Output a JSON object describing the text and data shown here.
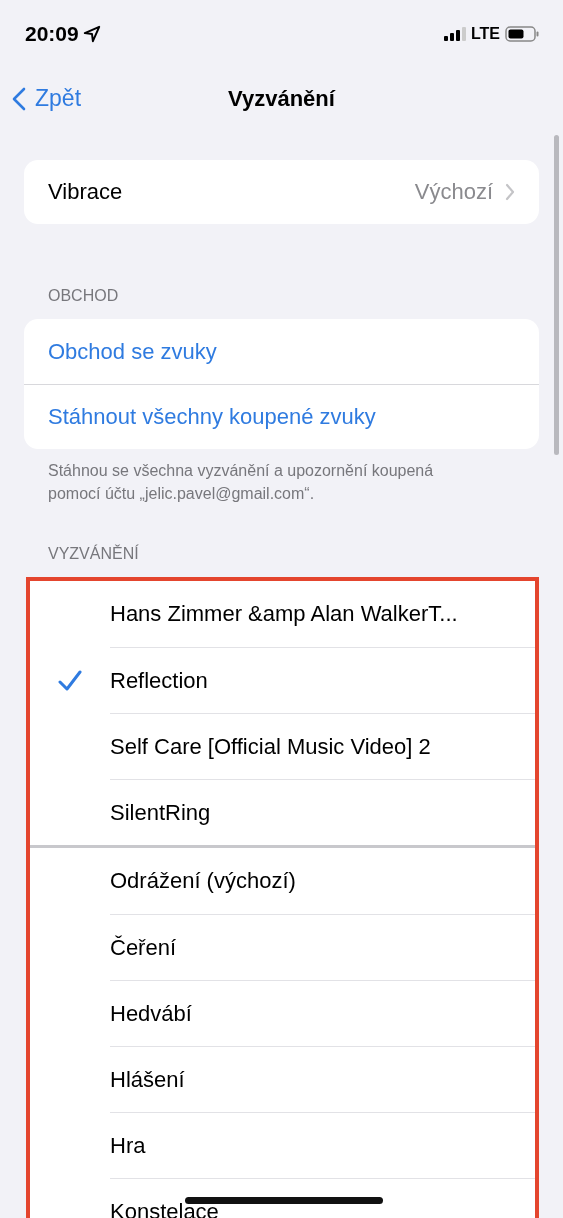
{
  "status_bar": {
    "time": "20:09",
    "network": "LTE"
  },
  "nav": {
    "back": "Zpět",
    "title": "Vyzvánění"
  },
  "vibration": {
    "label": "Vibrace",
    "value": "Výchozí"
  },
  "store": {
    "header": "OBCHOD",
    "items": [
      "Obchod se zvuky",
      "Stáhnout všechny koupené zvuky"
    ],
    "footer": "Stáhnou se všechna vyzvánění a upozornění koupená pomocí účtu „jelic.pavel@gmail.com“."
  },
  "ringtones": {
    "header": "VYZVÁNĚNÍ",
    "groups": [
      [
        {
          "label": "Hans Zimmer &amp Alan WalkerT...",
          "selected": false
        },
        {
          "label": "Reflection",
          "selected": true
        },
        {
          "label": "Self Care [Official Music Video] 2",
          "selected": false
        },
        {
          "label": "SilentRing",
          "selected": false
        }
      ],
      [
        {
          "label": "Odrážení (výchozí)",
          "selected": false
        },
        {
          "label": "Čeření",
          "selected": false
        },
        {
          "label": "Hedvábí",
          "selected": false
        },
        {
          "label": "Hlášení",
          "selected": false
        },
        {
          "label": "Hra",
          "selected": false
        },
        {
          "label": "Konstelace",
          "selected": false
        }
      ]
    ]
  }
}
